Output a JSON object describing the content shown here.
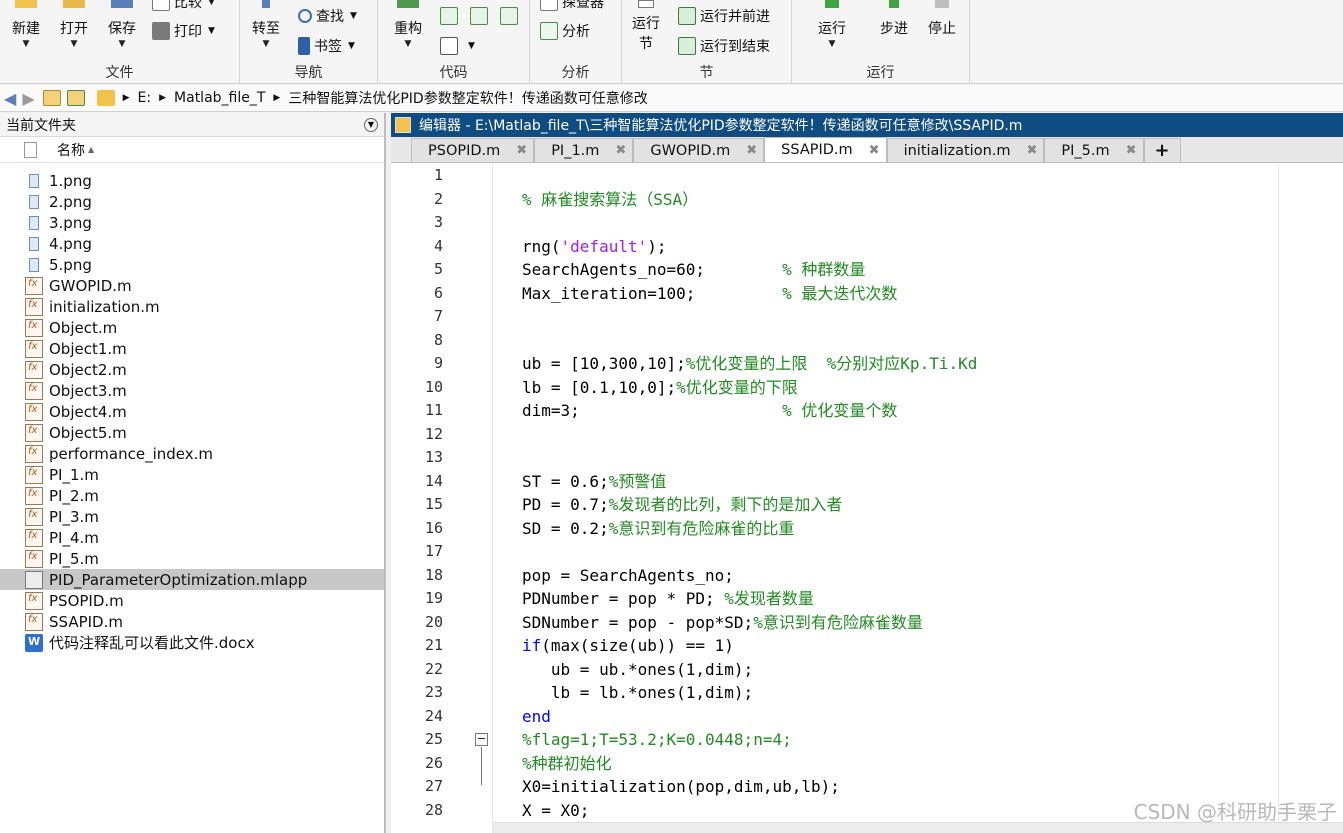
{
  "ribbon": {
    "file_group": {
      "label": "文件",
      "new": "新建",
      "open": "打开",
      "save": "保存",
      "compare": "比较",
      "print": "打印"
    },
    "nav_group": {
      "label": "导航",
      "goto": "转至",
      "find": "查找",
      "bookmark": "书签"
    },
    "code_group": {
      "label": "代码",
      "refactor": "重构"
    },
    "analyze_group": {
      "label": "分析",
      "profiler": "探查器",
      "analyze": "分析"
    },
    "section_group": {
      "label": "节",
      "run_section": "运行节",
      "run_advance": "运行并前进",
      "run_to_end": "运行到结束"
    },
    "run_group": {
      "label": "运行",
      "run": "运行",
      "step": "步进",
      "stop": "停止"
    }
  },
  "address": {
    "crumbs": [
      "E:",
      "Matlab_file_T",
      "三种智能算法优化PID参数整定软件！传递函数可任意修改"
    ]
  },
  "file_browser": {
    "title": "当前文件夹",
    "column_name": "名称",
    "files": [
      {
        "name": "1.png",
        "type": "png"
      },
      {
        "name": "2.png",
        "type": "png"
      },
      {
        "name": "3.png",
        "type": "png"
      },
      {
        "name": "4.png",
        "type": "png"
      },
      {
        "name": "5.png",
        "type": "png"
      },
      {
        "name": "GWOPID.m",
        "type": "m"
      },
      {
        "name": "initialization.m",
        "type": "m"
      },
      {
        "name": "Object.m",
        "type": "m"
      },
      {
        "name": "Object1.m",
        "type": "m"
      },
      {
        "name": "Object2.m",
        "type": "m"
      },
      {
        "name": "Object3.m",
        "type": "m"
      },
      {
        "name": "Object4.m",
        "type": "m"
      },
      {
        "name": "Object5.m",
        "type": "m"
      },
      {
        "name": "performance_index.m",
        "type": "m"
      },
      {
        "name": "PI_1.m",
        "type": "m"
      },
      {
        "name": "PI_2.m",
        "type": "m"
      },
      {
        "name": "PI_3.m",
        "type": "m"
      },
      {
        "name": "PI_4.m",
        "type": "m"
      },
      {
        "name": "PI_5.m",
        "type": "m"
      },
      {
        "name": "PID_ParameterOptimization.mlapp",
        "type": "mlapp",
        "selected": true
      },
      {
        "name": "PSOPID.m",
        "type": "m"
      },
      {
        "name": "SSAPID.m",
        "type": "m"
      },
      {
        "name": "代码注释乱可以看此文件.docx",
        "type": "docx"
      }
    ]
  },
  "editor": {
    "title": "编辑器 - E:\\Matlab_file_T\\三种智能算法优化PID参数整定软件！传递函数可任意修改\\SSAPID.m",
    "tabs": [
      {
        "label": "PSOPID.m",
        "active": false
      },
      {
        "label": "PI_1.m",
        "active": false
      },
      {
        "label": "GWOPID.m",
        "active": false
      },
      {
        "label": "SSAPID.m",
        "active": true
      },
      {
        "label": "initialization.m",
        "active": false
      },
      {
        "label": "PI_5.m",
        "active": false
      }
    ],
    "fold_line": 25,
    "lines": [
      [],
      [
        [
          "cm",
          "% 麻雀搜索算法（SSA）"
        ]
      ],
      [],
      [
        [
          "df",
          "rng("
        ],
        [
          "st",
          "'default'"
        ],
        [
          "df",
          ");"
        ]
      ],
      [
        [
          "df",
          "SearchAgents_no=60;        "
        ],
        [
          "cm",
          "% 种群数量"
        ]
      ],
      [
        [
          "df",
          "Max_iteration=100;         "
        ],
        [
          "cm",
          "% 最大迭代次数"
        ]
      ],
      [],
      [],
      [
        [
          "df",
          "ub = [10,300,10];"
        ],
        [
          "cm",
          "%优化变量的上限  %分别对应Kp.Ti.Kd"
        ]
      ],
      [
        [
          "df",
          "lb = [0.1,10,0];"
        ],
        [
          "cm",
          "%优化变量的下限"
        ]
      ],
      [
        [
          "df",
          "dim=3;                     "
        ],
        [
          "cm",
          "% 优化变量个数"
        ]
      ],
      [],
      [],
      [
        [
          "df",
          "ST = 0.6;"
        ],
        [
          "cm",
          "%预警值"
        ]
      ],
      [
        [
          "df",
          "PD = 0.7;"
        ],
        [
          "cm",
          "%发现者的比列，剩下的是加入者"
        ]
      ],
      [
        [
          "df",
          "SD = 0.2;"
        ],
        [
          "cm",
          "%意识到有危险麻雀的比重"
        ]
      ],
      [],
      [
        [
          "df",
          "pop = SearchAgents_no;"
        ]
      ],
      [
        [
          "df",
          "PDNumber = pop * PD; "
        ],
        [
          "cm",
          "%发现者数量"
        ]
      ],
      [
        [
          "df",
          "SDNumber = pop - pop*SD;"
        ],
        [
          "cm",
          "%意识到有危险麻雀数量"
        ]
      ],
      [
        [
          "kw",
          "if"
        ],
        [
          "df",
          "(max(size(ub)) == 1)"
        ]
      ],
      [
        [
          "df",
          "   ub = ub.*ones(1,dim);"
        ]
      ],
      [
        [
          "df",
          "   lb = lb.*ones(1,dim);"
        ]
      ],
      [
        [
          "kw",
          "end"
        ]
      ],
      [
        [
          "cm",
          "%flag=1;T=53.2;K=0.0448;n=4;"
        ]
      ],
      [
        [
          "cm",
          "%种群初始化"
        ]
      ],
      [
        [
          "df",
          "X0=initialization(pop,dim,ub,lb);"
        ]
      ],
      [
        [
          "df",
          "X = X0;"
        ]
      ]
    ]
  },
  "watermark": "CSDN @科研助手栗子",
  "colors": {
    "editor_title_bg": "#0f4c81",
    "comment": "#228b22",
    "keyword": "#0000ff",
    "string": "#a020f0"
  }
}
